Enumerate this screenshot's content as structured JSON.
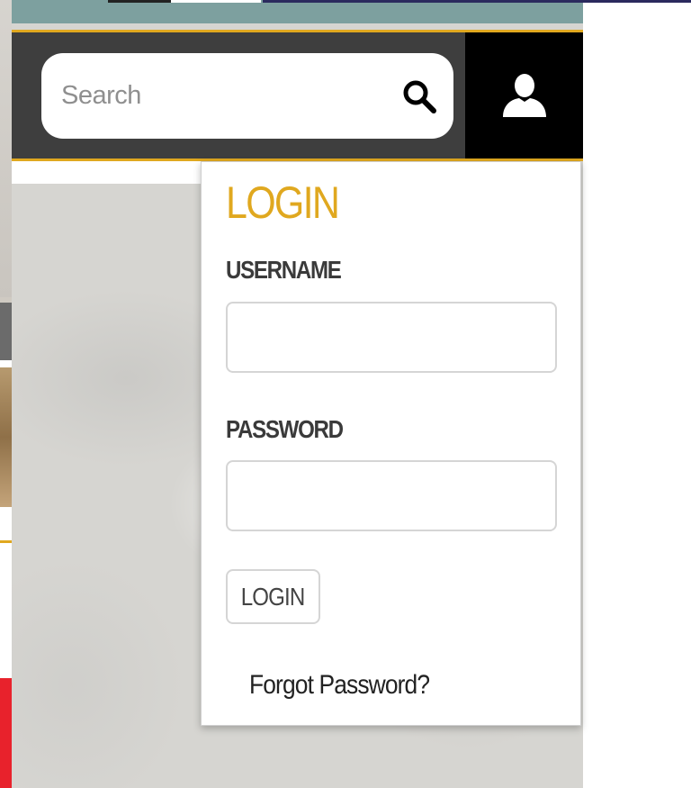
{
  "header": {
    "search": {
      "placeholder": "Search",
      "value": ""
    },
    "icons": {
      "search": "search-icon",
      "user": "user-icon"
    }
  },
  "login_panel": {
    "title": "LOGIN",
    "username": {
      "label": "USERNAME",
      "value": ""
    },
    "password": {
      "label": "PASSWORD",
      "value": ""
    },
    "submit_label": "LOGIN",
    "forgot_link": "Forgot Password?"
  },
  "colors": {
    "accent_gold": "#e0a81f",
    "header_bg": "#3e3e3e",
    "user_box_bg": "#000000",
    "top_band": "#7da09f",
    "label_text": "#3a3a3a"
  }
}
